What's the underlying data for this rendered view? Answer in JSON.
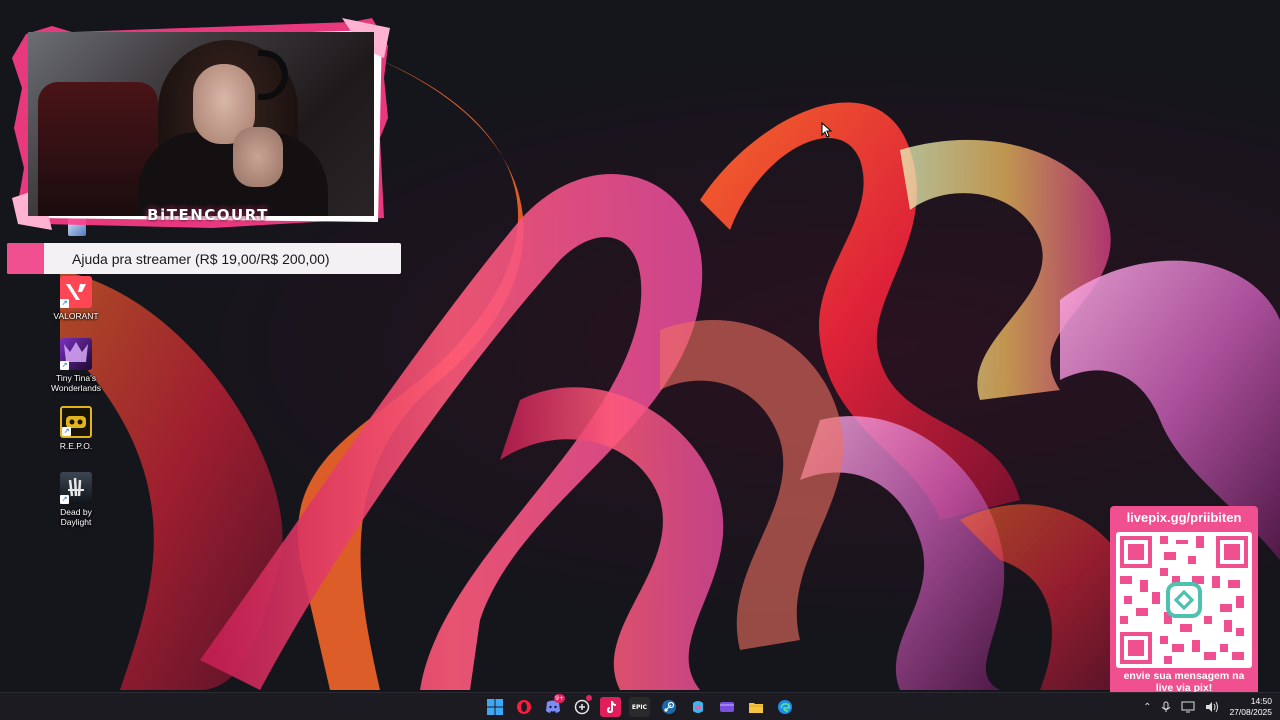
{
  "overlay": {
    "streamer_name": "BiTENCOURT",
    "donation_goal": "Ajuda pra streamer (R$ 19,00/R$ 200,00)",
    "livepix_url": "livepix.gg/priibiten",
    "livepix_message_line1": "envie sua mensagem na",
    "livepix_message_line2": "live via pix!"
  },
  "desktop_icons": [
    {
      "name": "VALORANT",
      "label_line1": "VALORANT",
      "label_line2": ""
    },
    {
      "name": "tiny-tinas-wonderlands",
      "label_line1": "Tiny Tina's",
      "label_line2": "Wonderlands"
    },
    {
      "name": "repo",
      "label_line1": "R.E.P.O.",
      "label_line2": ""
    },
    {
      "name": "dead-by-daylight",
      "label_line1": "Dead by",
      "label_line2": "Daylight"
    }
  ],
  "taskbar": {
    "apps": [
      "start",
      "opera-gx",
      "discord",
      "chatgpt",
      "tiktok",
      "epic-games",
      "steam",
      "copilot",
      "clipchamp",
      "file-explorer",
      "edge"
    ],
    "discord_badge": "9+",
    "epic_label": "EPIC",
    "clock_time": "14:50",
    "clock_date": "27/08/2025"
  },
  "colors": {
    "accent_pink": "#f0508f",
    "taskbar_bg": "#1c1b22",
    "wallpaper_bg": "#15151c"
  }
}
